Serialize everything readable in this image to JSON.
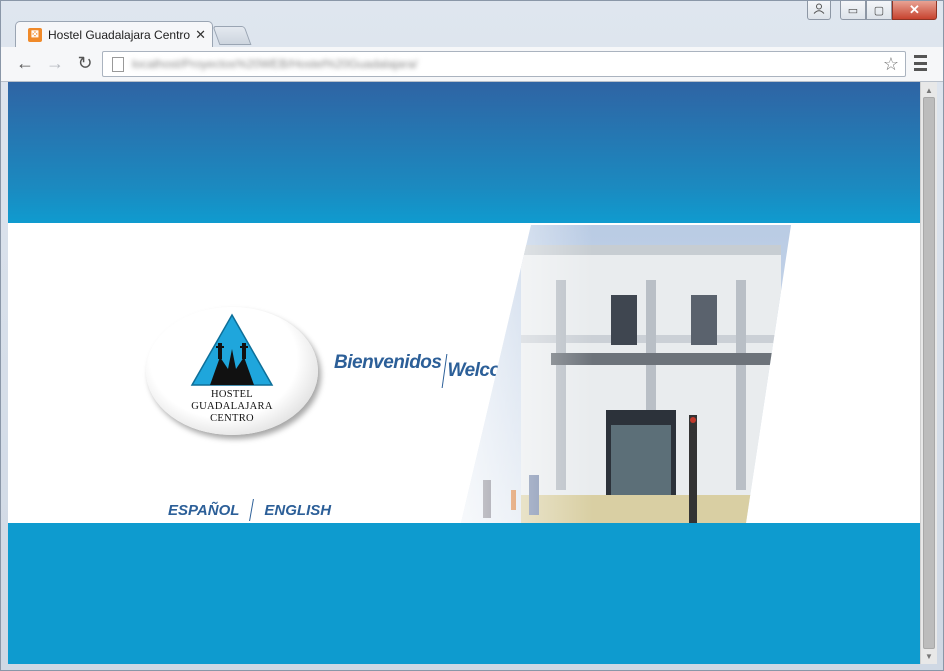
{
  "window": {
    "minimize_glyph": "▭",
    "maximize_glyph": "▢",
    "close_glyph": "✕"
  },
  "tab": {
    "favicon_letter": "⊠",
    "title": "Hostel Guadalajara Centro",
    "close_glyph": "✕"
  },
  "toolbar": {
    "back_glyph": "←",
    "forward_glyph": "→",
    "reload_glyph": "↻",
    "url": "localhost/Proyectos%20WEB/Hostel%20Guadalajara/",
    "star_glyph": "☆"
  },
  "page": {
    "logo_line1": "HOSTEL",
    "logo_line2": "GUADALAJARA",
    "logo_line3": "CENTRO",
    "welcome_es": "Bienvenidos",
    "welcome_en": "Welcome",
    "lang_es": "ESPAÑOL",
    "lang_en": "ENGLISH",
    "colors": {
      "header_band_top": "#2f64a4",
      "header_band_bottom": "#0f9bcf",
      "footer_band": "#0e9bcf",
      "text_blue": "#2c5f98",
      "triangle": "#1fa6dc"
    }
  },
  "scrollbar": {
    "up_glyph": "▲",
    "down_glyph": "▼"
  }
}
